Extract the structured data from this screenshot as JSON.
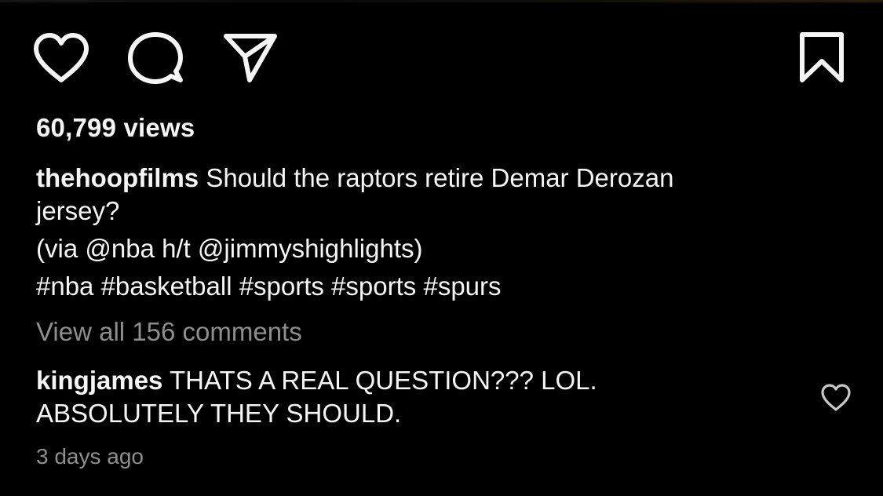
{
  "actions": {
    "like_icon": "heart-outline",
    "comment_icon": "speech-bubble-outline",
    "share_icon": "paper-plane-outline",
    "save_icon": "bookmark-outline"
  },
  "views": {
    "text": "60,799 views"
  },
  "caption": {
    "username": "thehoopfilms",
    "text_line1": "Should the raptors retire Demar Derozan",
    "text_line2": "jersey?",
    "credit": "(via @nba h/t @jimmyshighlights)",
    "hashtags": "#nba #basketball #sports #sports #spurs"
  },
  "comments_link": {
    "text": "View all 156 comments"
  },
  "top_comment": {
    "username": "kingjames",
    "text_line1": "THATS A REAL QUESTION??? LOL.",
    "text_line2": "ABSOLUTELY THEY SHOULD.",
    "like_icon": "heart-outline-small",
    "timestamp": "3 days ago"
  },
  "colors": {
    "background": "#000000",
    "primary_text": "#f5f5f5",
    "secondary_text": "#8e8e8e"
  }
}
